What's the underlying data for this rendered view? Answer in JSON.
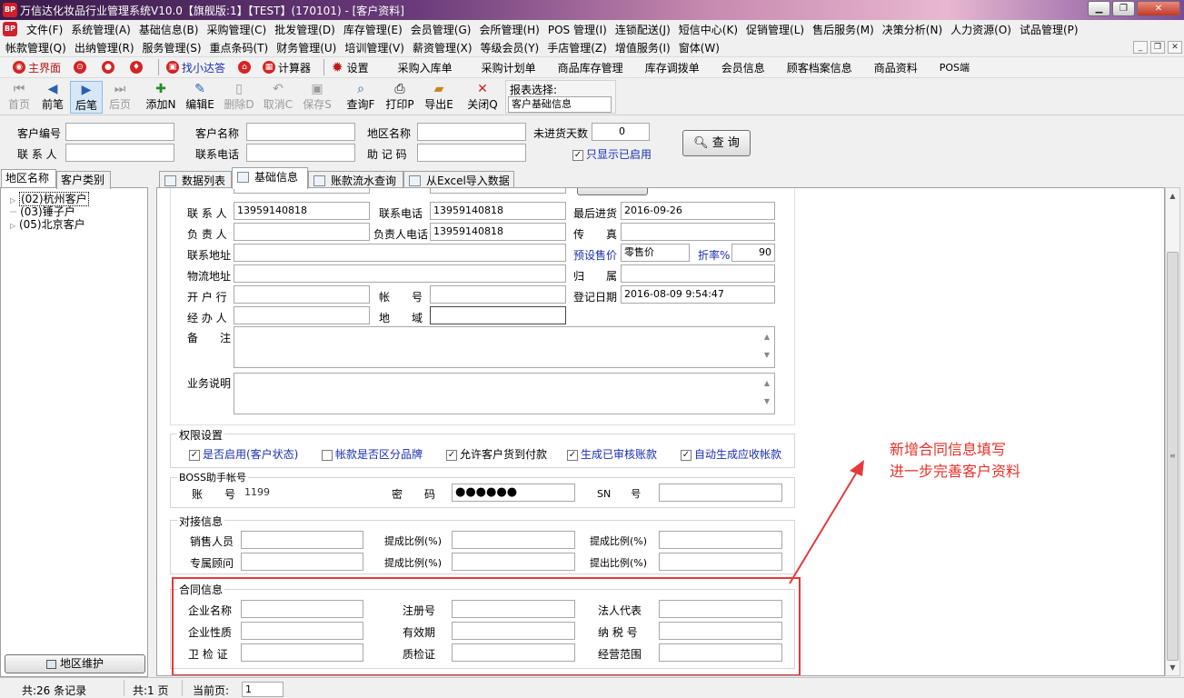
{
  "window": {
    "title": "万信达化妆品行业管理系统V10.0【旗舰版:1】【TEST】(170101) - [客户资料]",
    "app_icon": "BP"
  },
  "menu": {
    "row1": [
      "文件(F)",
      "系统管理(A)",
      "基础信息(B)",
      "采购管理(C)",
      "批发管理(D)",
      "库存管理(E)",
      "会员管理(G)",
      "会所管理(H)",
      "POS 管理(I)",
      "连锁配送(J)",
      "短信中心(K)",
      "促销管理(L)",
      "售后服务(M)",
      "决策分析(N)",
      "人力资源(O)",
      "试品管理(P)"
    ],
    "row2": [
      "帐款管理(Q)",
      "出纳管理(R)",
      "服务管理(S)",
      "重点条码(T)",
      "财务管理(U)",
      "培训管理(V)",
      "薪资管理(X)",
      "等级会员(Y)",
      "手店管理(Z)",
      "增值服务(I)",
      "窗体(W)"
    ]
  },
  "quick": {
    "home": "主界面",
    "find": "找小达答",
    "calc": "计算器",
    "settings": "设置",
    "links": [
      "采购入库单",
      "采购计划单",
      "商品库存管理",
      "库存调拨单",
      "会员信息",
      "顾客档案信息",
      "商品资料",
      "POS端"
    ]
  },
  "toolbar": {
    "buttons": [
      "首页",
      "前笔",
      "后笔",
      "后页",
      "添加N",
      "编辑E",
      "删除D",
      "取消C",
      "保存S",
      "查询F",
      "打印P",
      "导出E",
      "关闭Q"
    ],
    "report_label": "报表选择:",
    "report_value": "客户基础信息"
  },
  "filter": {
    "cust_no": "客户编号",
    "cust_name": "客户名称",
    "region_name": "地区名称",
    "no_purchase_days": "未进货天数",
    "no_purchase_value": "0",
    "contact": "联 系 人",
    "phone": "联系电话",
    "memo_code": "助 记 码",
    "only_enabled": "只显示已启用",
    "query": "查 询"
  },
  "left": {
    "tab1": "地区名称",
    "tab2": "客户类别",
    "tree": [
      "(02)杭州客户",
      "(03)锤子户",
      "(05)北京客户"
    ],
    "maint_btn": "地区维护"
  },
  "tabs": [
    "数据列表",
    "基础信息",
    "账款流水查询",
    "从Excel导入数据"
  ],
  "form": {
    "contact_lbl": "联 系 人",
    "contact_val": "13959140818",
    "phone_lbl": "联系电话",
    "phone_val": "13959140818",
    "last_in_lbl": "最后进货",
    "last_in_val": "2016-09-26",
    "owner_lbl": "负 责 人",
    "owner_phone_lbl": "负责人电话",
    "owner_phone_val": "13959140818",
    "fax_lbl": "传　　真",
    "addr_lbl": "联系地址",
    "price_lbl": "预设售价",
    "price_val": "零售价",
    "disc_lbl": "折率%",
    "disc_val": "90",
    "logistic_lbl": "物流地址",
    "belong_lbl": "归　　属",
    "bank_lbl": "开 户 行",
    "acct_lbl": "帐　　号",
    "reg_date_lbl": "登记日期",
    "reg_date_val": "2016-08-09 9:54:47",
    "handler_lbl": "经 办 人",
    "area_lbl": "地　　域",
    "remark_lbl": "备　　注",
    "biz_lbl": "业务说明"
  },
  "perm": {
    "title": "权限设置",
    "items": [
      "是否启用(客户状态)",
      "帐款是否区分品牌",
      "允许客户货到付款",
      "生成已审核账款",
      "自动生成应收帐款"
    ]
  },
  "boss": {
    "title": "BOSS助手帐号",
    "acct_lbl": "账　　号",
    "acct_val": "1199",
    "pwd_lbl": "密　　码",
    "pwd_val": "●●●●●●",
    "sn_lbl": "SN　　号"
  },
  "dock": {
    "title": "对接信息",
    "sales": "销售人员",
    "ratio1": "提成比例(%)",
    "ratio2": "提成比例(%)",
    "advisor": "专属顾问",
    "ratio3": "提成比例(%)",
    "ratio4": "提出比例(%)"
  },
  "contract": {
    "title": "合同信息",
    "ent_name": "企业名称",
    "reg_no": "注册号",
    "legal": "法人代表",
    "ent_type": "企业性质",
    "valid": "有效期",
    "tax_no": "纳 税 号",
    "hyg": "卫 检 证",
    "qc": "质检证",
    "scope": "经营范围"
  },
  "annotation": {
    "line1": "新增合同信息填写",
    "line2": "进一步完善客户资料"
  },
  "status": {
    "records": "共:26 条记录",
    "pages": "共:1 页",
    "cur_lbl": "当前页:",
    "cur_val": "1"
  }
}
